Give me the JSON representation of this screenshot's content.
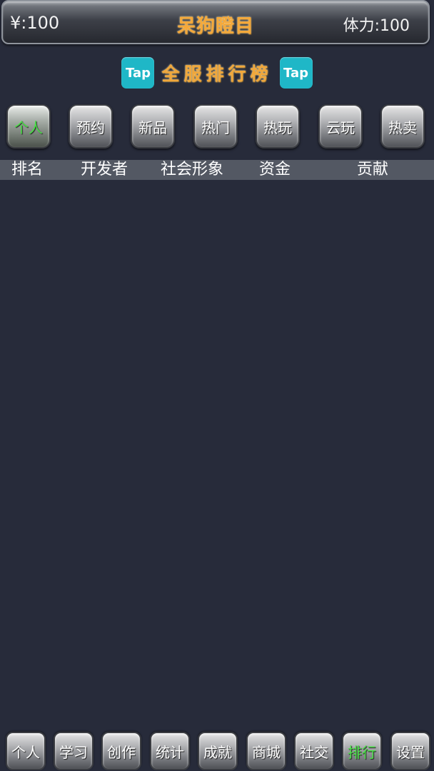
{
  "header": {
    "money": "¥:100",
    "title": "呆狗瞪目",
    "stamina": "体力:100"
  },
  "board": {
    "badge_left": "Tap",
    "title": "全服排行榜",
    "badge_right": "Tap"
  },
  "tabs": [
    {
      "label": "个人",
      "active": true
    },
    {
      "label": "预约",
      "active": false
    },
    {
      "label": "新品",
      "active": false
    },
    {
      "label": "热门",
      "active": false
    },
    {
      "label": "热玩",
      "active": false
    },
    {
      "label": "云玩",
      "active": false
    },
    {
      "label": "热卖",
      "active": false
    }
  ],
  "columns": [
    "排名",
    "开发者",
    "社会形象",
    "资金",
    "贡献"
  ],
  "bottom_nav": [
    {
      "label": "个人",
      "active": false
    },
    {
      "label": "学习",
      "active": false
    },
    {
      "label": "创作",
      "active": false
    },
    {
      "label": "统计",
      "active": false
    },
    {
      "label": "成就",
      "active": false
    },
    {
      "label": "商城",
      "active": false
    },
    {
      "label": "社交",
      "active": false
    },
    {
      "label": "排行",
      "active": true
    },
    {
      "label": "设置",
      "active": false
    }
  ],
  "colors": {
    "background": "#272b3a",
    "title_orange": "#f0a73b",
    "tap_badge": "#1fb7c7",
    "active_green": "#49e046",
    "header_row": "#535863"
  }
}
